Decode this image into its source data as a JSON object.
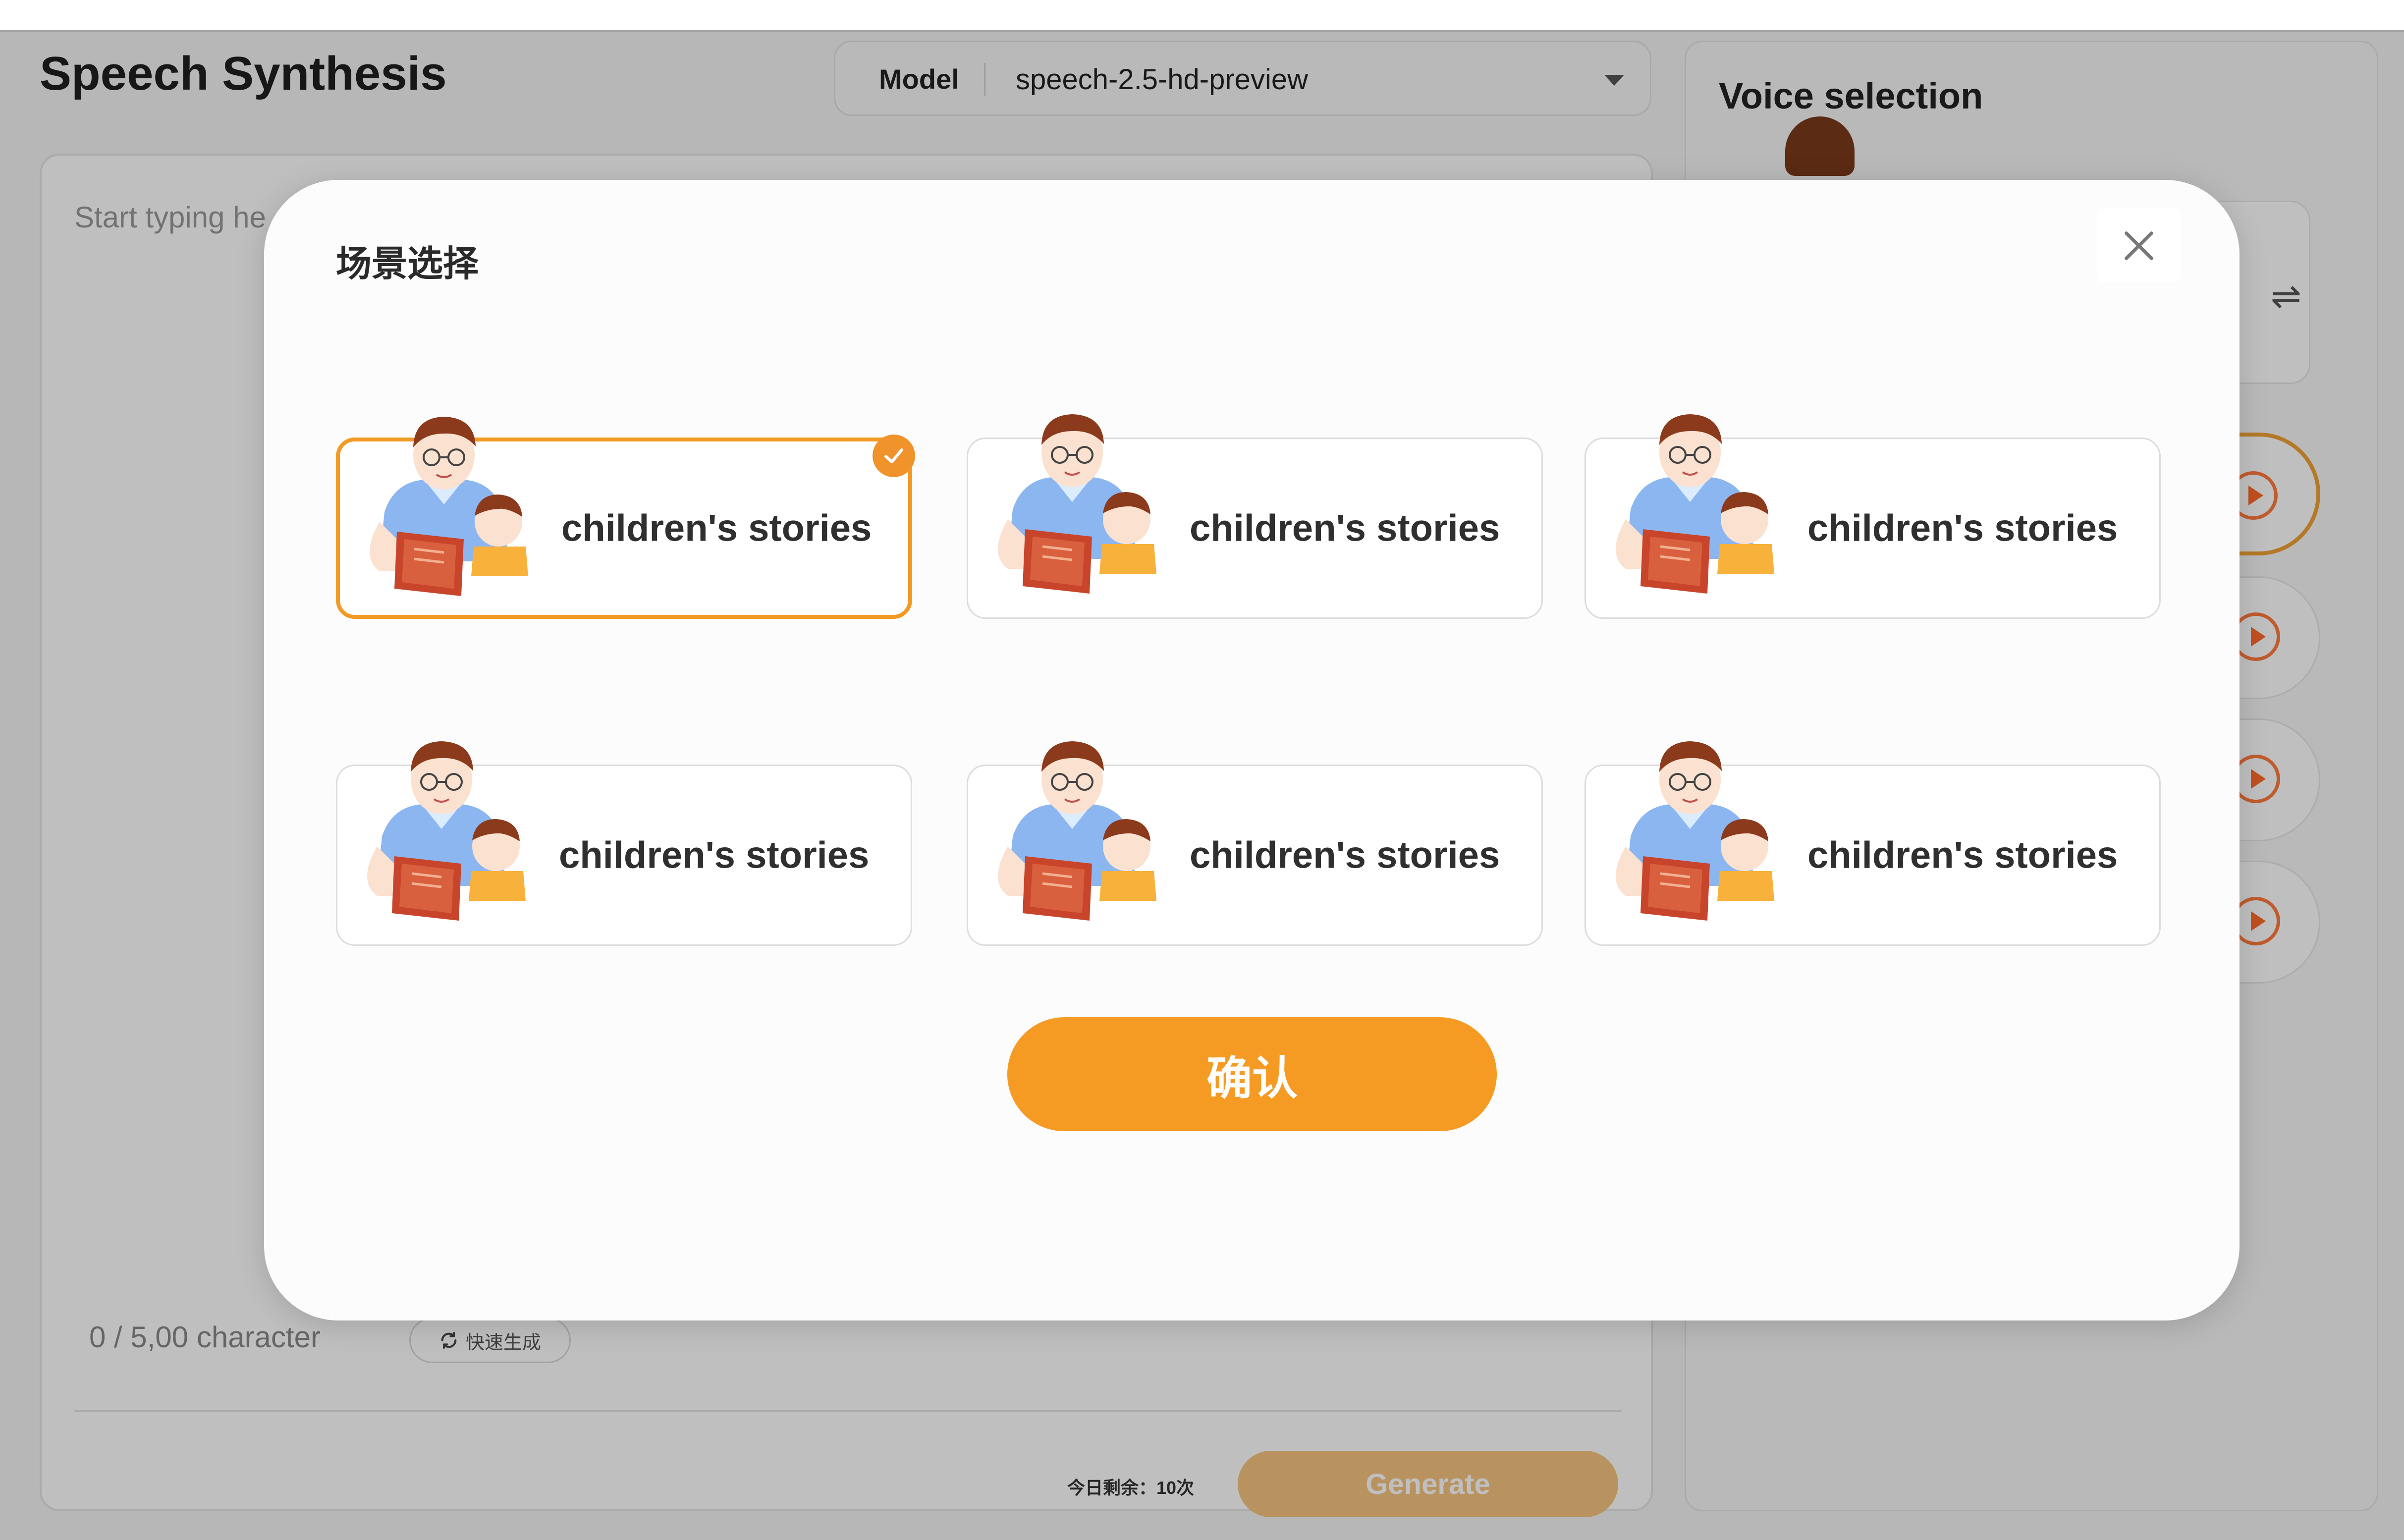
{
  "app": {
    "title": "Speech Synthesis",
    "model": {
      "label": "Model",
      "value": "speech-2.5-hd-preview"
    }
  },
  "editor": {
    "placeholder_partial": "Start typing he",
    "char_count": "0 / 5,00 character",
    "quick_generate": "快速生成",
    "remaining": "今日剩余：10次",
    "generate": "Generate"
  },
  "voice_panel": {
    "title": "Voice selection",
    "swap_icon": "⇌"
  },
  "modal": {
    "title": "场景选择",
    "scenes": [
      {
        "label": "children's stories",
        "selected": true
      },
      {
        "label": "children's stories",
        "selected": false
      },
      {
        "label": "children's stories",
        "selected": false
      },
      {
        "label": "children's stories",
        "selected": false
      },
      {
        "label": "children's stories",
        "selected": false
      },
      {
        "label": "children's stories",
        "selected": false
      }
    ],
    "confirm": "确认"
  },
  "colors": {
    "accent": "#f59b24",
    "selected_border": "#f39a24",
    "play_icon": "#ff6a2a",
    "generate_disabled": "#f6c480"
  },
  "icons": {
    "caret": "chevron-down-icon",
    "close": "close-icon",
    "check": "check-icon",
    "refresh": "refresh-icon",
    "play": "play-icon",
    "swap": "swap-icon"
  }
}
